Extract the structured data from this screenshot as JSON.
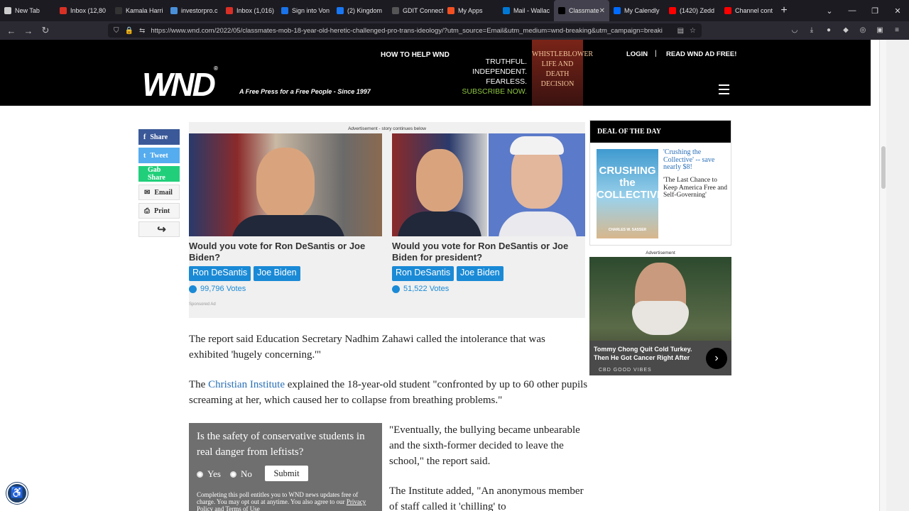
{
  "browser": {
    "tabs": [
      {
        "label": "New Tab",
        "color": "#cccccc"
      },
      {
        "label": "Inbox (12,80",
        "color": "#d93025"
      },
      {
        "label": "Kamala Harri",
        "color": "#333333"
      },
      {
        "label": "investorpro.c",
        "color": "#4a90d9"
      },
      {
        "label": "Inbox (1,016)",
        "color": "#d93025"
      },
      {
        "label": "Sign into Von",
        "color": "#1a73e8"
      },
      {
        "label": "(2) Kingdom",
        "color": "#1877f2"
      },
      {
        "label": "GDIT Connect",
        "color": "#555555"
      },
      {
        "label": "My Apps",
        "color": "#f25022"
      },
      {
        "label": "Mail - Wallac",
        "color": "#0078d4"
      },
      {
        "label": "Classmate",
        "color": "#000000",
        "active": true
      },
      {
        "label": "My Calendly",
        "color": "#006bff"
      },
      {
        "label": "(1420) Zedd",
        "color": "#ff0000"
      },
      {
        "label": "Channel cont",
        "color": "#ff0000"
      }
    ],
    "url": "https://www.wnd.com/2022/05/classmates-mob-18-year-old-heretic-challenged-pro-trans-ideology/?utm_source=Email&utm_medium=wnd-breaking&utm_campaign=breaki"
  },
  "header": {
    "logo": "WND",
    "logo_mark": "®",
    "tagline": "A Free Press for a Free People - Since 1997",
    "how_to_help": "HOW TO HELP WND",
    "promo_lines": [
      "TRUTHFUL.",
      "INDEPENDENT.",
      "FEARLESS."
    ],
    "promo_subscribe": "SUBSCRIBE NOW.",
    "book_text": "WHISTLEBLOWER LIFE AND DEATH DECISION",
    "login": "LOGIN",
    "separator": "|",
    "ad_free": "READ WND AD FREE!"
  },
  "share": [
    {
      "label": "Share",
      "icon": "f",
      "color": "#3b5998"
    },
    {
      "label": "Tweet",
      "icon": "t",
      "color": "#55acee"
    },
    {
      "label": "Gab Share",
      "icon": "",
      "color": "#21cf7a"
    },
    {
      "label": "Email",
      "icon": "✉",
      "color": "#f5f5f5"
    },
    {
      "label": "Print",
      "icon": "⎙",
      "color": "#f5f5f5"
    },
    {
      "label": "",
      "icon": "↪",
      "color": "#f5f5f5"
    }
  ],
  "ad": {
    "caption": "Advertisement - story continues below",
    "left_question": "Would you vote for Ron DeSantis or Joe Biden?",
    "right_question": "Would you vote for Ron DeSantis or Joe Biden for president?",
    "option_a": "Ron DeSantis",
    "option_b": "Joe Biden",
    "left_votes": "99,796 Votes",
    "right_votes": "51,522 Votes",
    "sponsored": "Sponsored Ad"
  },
  "article": {
    "p1": "The report said Education Secretary Nadhim Zahawi called the intolerance that was exhibited 'hugely concerning.'\"",
    "p2_pre": "The ",
    "p2_link": "Christian Institute",
    "p2_post": " explained the 18-year-old student \"confronted by up to 60 other pupils screaming at her, which caused her to collapse from breathing problems.\"",
    "p3": "\"Eventually, the bullying became unbearable and the sixth-former decided to leave the school,\" the report said.",
    "p4": "The Institute added, \"An anonymous member of staff called it 'chilling' to"
  },
  "poll": {
    "question": "Is the safety of conservative students in real danger from leftists?",
    "yes": "Yes",
    "no": "No",
    "submit": "Submit",
    "fine_print": "Completing this poll entitles you to WND news updates free of charge. You may opt out at anytime. You also agree to our ",
    "fine_link": "Privacy Policy and Terms of Use"
  },
  "deal": {
    "heading": "DEAL OF THE DAY",
    "cover_title": "CRUSHING the COLLECTIVE",
    "cover_author": "CHARLES W. SASSER",
    "link": "'Crushing the Collective' -- save nearly $8!",
    "subtitle": "'The Last Chance to Keep America Free and Self-Governing'"
  },
  "ad2": {
    "caption": "Advertisement",
    "headline": "Tommy Chong Quit Cold Turkey. Then He Got Cancer Right After",
    "brand": "CBD GOOD VIBES"
  }
}
